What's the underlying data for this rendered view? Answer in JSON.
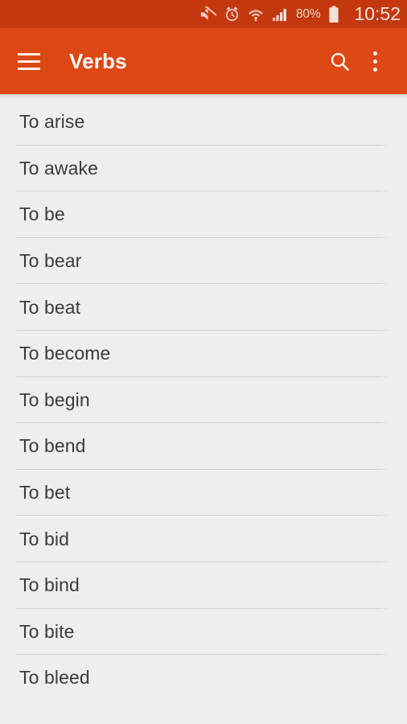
{
  "status_bar": {
    "background_color": "#c3380f",
    "icons": [
      {
        "name": "mute-icon",
        "label": "Silent mode"
      },
      {
        "name": "alarm-icon",
        "label": "Alarm set"
      },
      {
        "name": "wifi-icon",
        "label": "Wi-Fi connected"
      },
      {
        "name": "signal-icon",
        "label": "Cellular signal"
      }
    ],
    "battery_percent": "80%",
    "battery_icon": "battery-icon",
    "time": "10:52"
  },
  "app_bar": {
    "background_color": "#dd4814",
    "menu_icon": "hamburger-menu-icon",
    "title": "Verbs",
    "actions": [
      {
        "name": "search-icon",
        "label": "Search"
      },
      {
        "name": "overflow-menu-icon",
        "label": "More options"
      }
    ]
  },
  "list": {
    "background_color": "#eeeeee",
    "text_color": "#3b3b3b",
    "items": [
      {
        "label": "To arise"
      },
      {
        "label": "To awake"
      },
      {
        "label": "To be"
      },
      {
        "label": "To bear"
      },
      {
        "label": "To beat"
      },
      {
        "label": "To become"
      },
      {
        "label": "To begin"
      },
      {
        "label": "To bend"
      },
      {
        "label": "To bet"
      },
      {
        "label": "To bid"
      },
      {
        "label": "To bind"
      },
      {
        "label": "To bite"
      },
      {
        "label": "To bleed"
      }
    ]
  }
}
